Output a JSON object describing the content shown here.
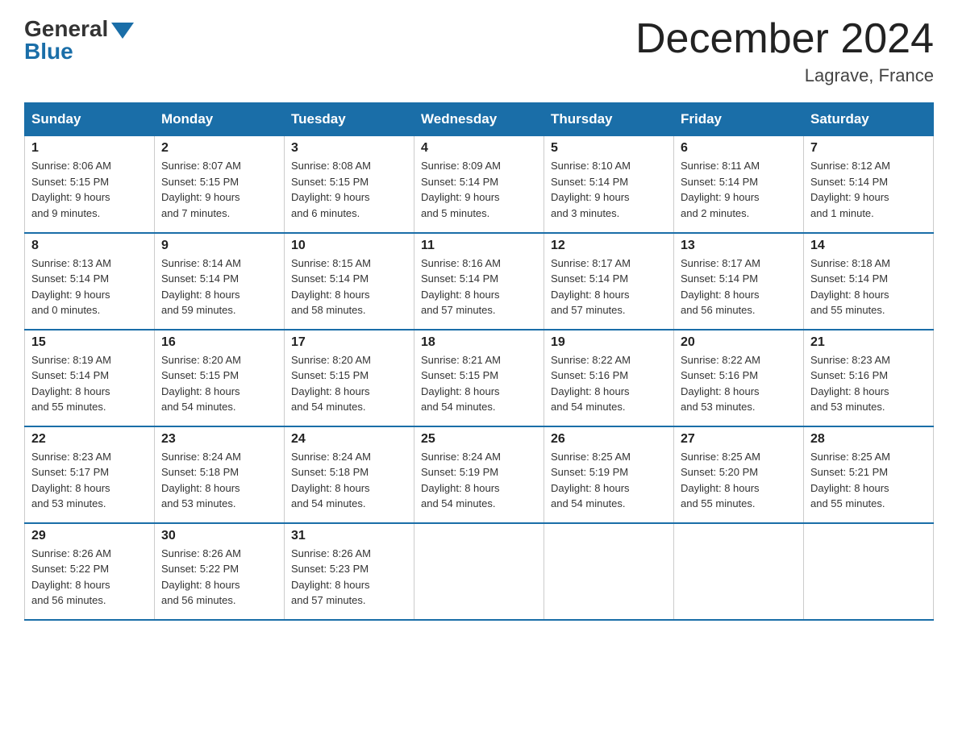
{
  "header": {
    "logo_general": "General",
    "logo_blue": "Blue",
    "title": "December 2024",
    "location": "Lagrave, France"
  },
  "days_of_week": [
    "Sunday",
    "Monday",
    "Tuesday",
    "Wednesday",
    "Thursday",
    "Friday",
    "Saturday"
  ],
  "weeks": [
    [
      {
        "day": "1",
        "sunrise": "8:06 AM",
        "sunset": "5:15 PM",
        "daylight": "9 hours and 9 minutes."
      },
      {
        "day": "2",
        "sunrise": "8:07 AM",
        "sunset": "5:15 PM",
        "daylight": "9 hours and 7 minutes."
      },
      {
        "day": "3",
        "sunrise": "8:08 AM",
        "sunset": "5:15 PM",
        "daylight": "9 hours and 6 minutes."
      },
      {
        "day": "4",
        "sunrise": "8:09 AM",
        "sunset": "5:14 PM",
        "daylight": "9 hours and 5 minutes."
      },
      {
        "day": "5",
        "sunrise": "8:10 AM",
        "sunset": "5:14 PM",
        "daylight": "9 hours and 3 minutes."
      },
      {
        "day": "6",
        "sunrise": "8:11 AM",
        "sunset": "5:14 PM",
        "daylight": "9 hours and 2 minutes."
      },
      {
        "day": "7",
        "sunrise": "8:12 AM",
        "sunset": "5:14 PM",
        "daylight": "9 hours and 1 minute."
      }
    ],
    [
      {
        "day": "8",
        "sunrise": "8:13 AM",
        "sunset": "5:14 PM",
        "daylight": "9 hours and 0 minutes."
      },
      {
        "day": "9",
        "sunrise": "8:14 AM",
        "sunset": "5:14 PM",
        "daylight": "8 hours and 59 minutes."
      },
      {
        "day": "10",
        "sunrise": "8:15 AM",
        "sunset": "5:14 PM",
        "daylight": "8 hours and 58 minutes."
      },
      {
        "day": "11",
        "sunrise": "8:16 AM",
        "sunset": "5:14 PM",
        "daylight": "8 hours and 57 minutes."
      },
      {
        "day": "12",
        "sunrise": "8:17 AM",
        "sunset": "5:14 PM",
        "daylight": "8 hours and 57 minutes."
      },
      {
        "day": "13",
        "sunrise": "8:17 AM",
        "sunset": "5:14 PM",
        "daylight": "8 hours and 56 minutes."
      },
      {
        "day": "14",
        "sunrise": "8:18 AM",
        "sunset": "5:14 PM",
        "daylight": "8 hours and 55 minutes."
      }
    ],
    [
      {
        "day": "15",
        "sunrise": "8:19 AM",
        "sunset": "5:14 PM",
        "daylight": "8 hours and 55 minutes."
      },
      {
        "day": "16",
        "sunrise": "8:20 AM",
        "sunset": "5:15 PM",
        "daylight": "8 hours and 54 minutes."
      },
      {
        "day": "17",
        "sunrise": "8:20 AM",
        "sunset": "5:15 PM",
        "daylight": "8 hours and 54 minutes."
      },
      {
        "day": "18",
        "sunrise": "8:21 AM",
        "sunset": "5:15 PM",
        "daylight": "8 hours and 54 minutes."
      },
      {
        "day": "19",
        "sunrise": "8:22 AM",
        "sunset": "5:16 PM",
        "daylight": "8 hours and 54 minutes."
      },
      {
        "day": "20",
        "sunrise": "8:22 AM",
        "sunset": "5:16 PM",
        "daylight": "8 hours and 53 minutes."
      },
      {
        "day": "21",
        "sunrise": "8:23 AM",
        "sunset": "5:16 PM",
        "daylight": "8 hours and 53 minutes."
      }
    ],
    [
      {
        "day": "22",
        "sunrise": "8:23 AM",
        "sunset": "5:17 PM",
        "daylight": "8 hours and 53 minutes."
      },
      {
        "day": "23",
        "sunrise": "8:24 AM",
        "sunset": "5:18 PM",
        "daylight": "8 hours and 53 minutes."
      },
      {
        "day": "24",
        "sunrise": "8:24 AM",
        "sunset": "5:18 PM",
        "daylight": "8 hours and 54 minutes."
      },
      {
        "day": "25",
        "sunrise": "8:24 AM",
        "sunset": "5:19 PM",
        "daylight": "8 hours and 54 minutes."
      },
      {
        "day": "26",
        "sunrise": "8:25 AM",
        "sunset": "5:19 PM",
        "daylight": "8 hours and 54 minutes."
      },
      {
        "day": "27",
        "sunrise": "8:25 AM",
        "sunset": "5:20 PM",
        "daylight": "8 hours and 55 minutes."
      },
      {
        "day": "28",
        "sunrise": "8:25 AM",
        "sunset": "5:21 PM",
        "daylight": "8 hours and 55 minutes."
      }
    ],
    [
      {
        "day": "29",
        "sunrise": "8:26 AM",
        "sunset": "5:22 PM",
        "daylight": "8 hours and 56 minutes."
      },
      {
        "day": "30",
        "sunrise": "8:26 AM",
        "sunset": "5:22 PM",
        "daylight": "8 hours and 56 minutes."
      },
      {
        "day": "31",
        "sunrise": "8:26 AM",
        "sunset": "5:23 PM",
        "daylight": "8 hours and 57 minutes."
      },
      null,
      null,
      null,
      null
    ]
  ],
  "labels": {
    "sunrise_prefix": "Sunrise: ",
    "sunset_prefix": "Sunset: ",
    "daylight_prefix": "Daylight: "
  }
}
